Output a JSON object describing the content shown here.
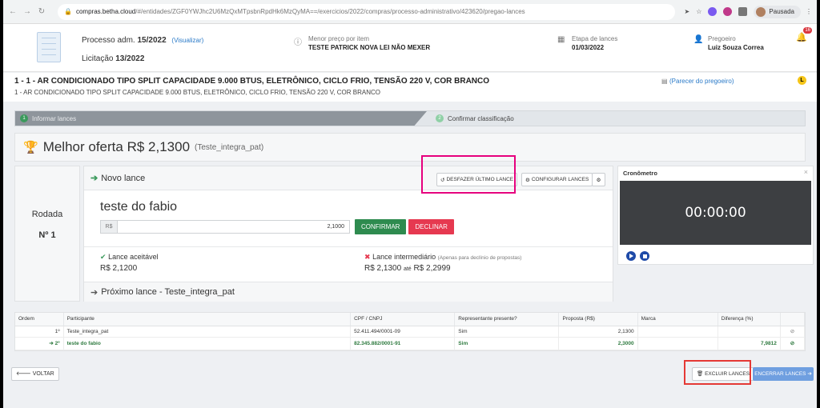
{
  "browser": {
    "url_host": "compras.betha.cloud",
    "url_path": "/#/entidades/ZGF0YWJhc2U6MzQxMTpsbnRpdHk6MzQyMA==/exercicios/2022/compras/processo-administrativo/423620/pregao-lances",
    "profile_status": "Pausada"
  },
  "header": {
    "processo_label": "Processo adm.",
    "processo_value": "15/2022",
    "visualizar": "(Visualizar)",
    "licitacao_label": "Licitação",
    "licitacao_value": "13/2022",
    "menor_preco_label": "Menor preço por item",
    "menor_preco_value": "TESTE PATRICK NOVA LEI NÃO MEXER",
    "etapa_label": "Etapa de lances",
    "etapa_value": "01/03/2022",
    "pregoeiro_label": "Pregoeiro",
    "pregoeiro_value": "Luiz Souza Correa",
    "notifications": "16"
  },
  "item": {
    "title": "1 - 1 - AR CONDICIONADO TIPO SPLIT CAPACIDADE 9.000 BTUS, ELETRÔNICO, CICLO FRIO, TENSÃO 220 V, COR BRANCO",
    "subtitle": "1 - AR CONDICIONADO TIPO SPLIT CAPACIDADE 9.000 BTUS, ELETRÔNICO, CICLO FRIO, TENSÃO 220 V, COR BRANCO",
    "parecer": "(Parecer do pregoeiro)",
    "badge": "L"
  },
  "steps": [
    {
      "num": "1",
      "label": "Informar lances"
    },
    {
      "num": "2",
      "label": "Confirmar classificação"
    }
  ],
  "best_offer": {
    "label": "Melhor oferta R$ 2,1300",
    "supplier": "(Teste_integra_pat)"
  },
  "rodada": {
    "label": "Rodada",
    "value": "Nº 1"
  },
  "lance": {
    "title": "Novo lance",
    "desfazer": "DESFAZER ÚLTIMO LANCE",
    "configurar": "CONFIGURAR LANCES",
    "bidder": "teste do fabio",
    "currency": "R$",
    "value": "2,1000",
    "confirmar": "CONFIRMAR",
    "declinar": "DECLINAR",
    "aceitavel_label": "Lance aceitável",
    "aceitavel_value": "R$ 2,1200",
    "intermediario_label": "Lance intermediário",
    "intermediario_note": "(Apenas para declínio de propostas)",
    "intermediario_from": "R$ 2,1300",
    "intermediario_ate": "até",
    "intermediario_to": "R$ 2,2999",
    "proximo": "Próximo lance - Teste_integra_pat"
  },
  "cronometro": {
    "title": "Cronômetro",
    "time": "00:00:00"
  },
  "table": {
    "headers": [
      "Ordem",
      "Participante",
      "CPF / CNPJ",
      "Representante presente?",
      "Proposta (R$)",
      "Marca",
      "Diferença (%)",
      ""
    ],
    "rows": [
      {
        "ordem": "1º",
        "participante": "Teste_integra_pat",
        "cnpj": "52.411.494/0001-09",
        "rep": "Sim",
        "proposta": "2,1300",
        "marca": "",
        "diferenca": ""
      },
      {
        "ordem": "➔ 2º",
        "participante": "teste do fabio",
        "cnpj": "82.345.882/0001-91",
        "rep": "Sim",
        "proposta": "2,3000",
        "marca": "",
        "diferenca": "7,9812"
      }
    ]
  },
  "footer": {
    "voltar": "VOLTAR",
    "excluir": "EXCLUIR LANCES",
    "encerrar": "ENCERRAR LANCES"
  },
  "colors": {
    "highlight": "#e6007e",
    "red_box": "#e53935",
    "green": "#2e8b4f",
    "blue": "#6f9fe0"
  }
}
